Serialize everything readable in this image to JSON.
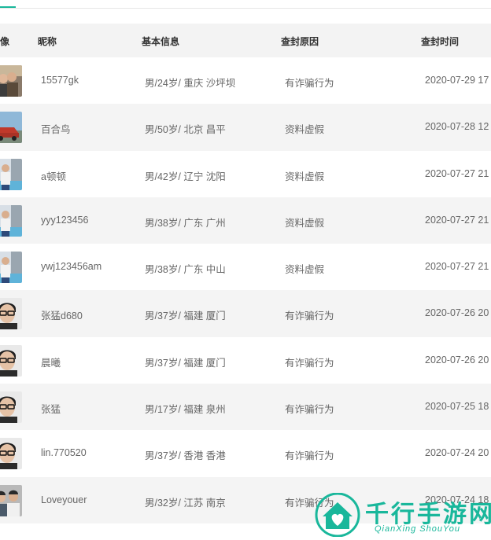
{
  "header": {
    "avatar": "像",
    "nickname": "昵称",
    "basic_info": "基本信息",
    "reason": "查封原因",
    "time": "查封时间"
  },
  "rows": [
    {
      "nickname": "15577gk",
      "info": "男/24岁/ 重庆 沙坪坝",
      "reason": "有诈骗行为",
      "time": "2020-07-29 17",
      "avatar": "couple-photo"
    },
    {
      "nickname": "百合鸟",
      "info": "男/50岁/ 北京 昌平",
      "reason": "资料虚假",
      "time": "2020-07-28 12",
      "avatar": "car-photo"
    },
    {
      "nickname": "a顿顿",
      "info": "男/42岁/ 辽宁 沈阳",
      "reason": "资料虚假",
      "time": "2020-07-27 21",
      "avatar": "poolside-photo"
    },
    {
      "nickname": "yyy123456",
      "info": "男/38岁/ 广东 广州",
      "reason": "资料虚假",
      "time": "2020-07-27 21",
      "avatar": "poolside-photo"
    },
    {
      "nickname": "ywj123456am",
      "info": "男/38岁/ 广东 中山",
      "reason": "资料虚假",
      "time": "2020-07-27 21",
      "avatar": "poolside-photo"
    },
    {
      "nickname": "张猛d680",
      "info": "男/37岁/ 福建 厦门",
      "reason": "有诈骗行为",
      "time": "2020-07-26 20",
      "avatar": "man-glasses-photo"
    },
    {
      "nickname": "晨曦",
      "info": "男/37岁/ 福建 厦门",
      "reason": "有诈骗行为",
      "time": "2020-07-26 20",
      "avatar": "man-glasses-photo"
    },
    {
      "nickname": "张猛",
      "info": "男/17岁/ 福建 泉州",
      "reason": "有诈骗行为",
      "time": "2020-07-25 18",
      "avatar": "man-glasses-photo"
    },
    {
      "nickname": "lin.770520",
      "info": "男/37岁/ 香港 香港",
      "reason": "有诈骗行为",
      "time": "2020-07-24 20",
      "avatar": "man-glasses-photo"
    },
    {
      "nickname": "Loveyouer",
      "info": "男/32岁/ 江苏 南京",
      "reason": "有诈骗行为",
      "time": "2020-07-24 18",
      "avatar": "group-photo"
    }
  ],
  "watermark": {
    "title": "千行手游网",
    "subtitle": "QianXing ShouYou",
    "color": "#19b79b"
  },
  "colors": {
    "accent": "#19b79b",
    "header_bg": "#f3f3f3",
    "stripe_bg": "#f4f4f4"
  }
}
